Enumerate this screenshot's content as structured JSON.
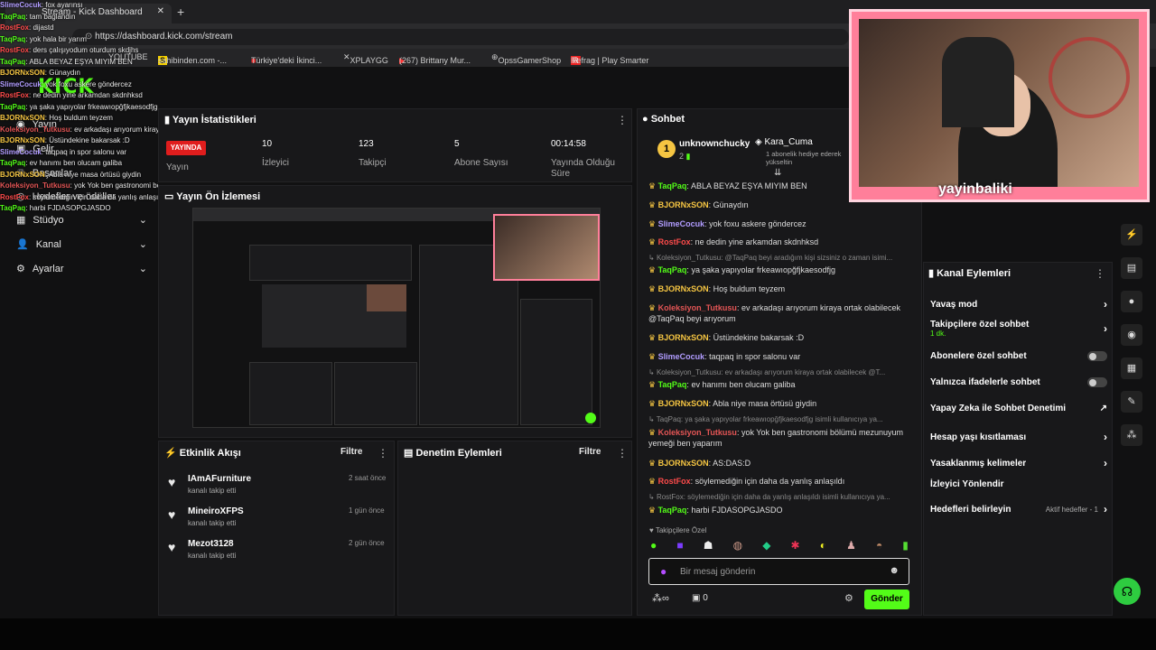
{
  "browser": {
    "tab_title": "Stream - Kick Dashboard",
    "url": "https://dashboard.kick.com/stream",
    "bookmarks": [
      "YOUTUBE",
      "sahibinden.com -...",
      "Türkiye'deki İkinci...",
      "XPLAYGG",
      "(267) Brittany Mur...",
      "OpssGamerShop",
      "Refrag | Play Smarter"
    ]
  },
  "overlay_chat": [
    {
      "u": "SlimeCocuk",
      "m": "fox ayarınsı",
      "c": "u1"
    },
    {
      "u": "TaqPaq",
      "m": "tam bağlandın",
      "c": "u2"
    },
    {
      "u": "RostFox",
      "m": "dijastd",
      "c": "u3"
    },
    {
      "u": "TaqPaq",
      "m": "yok hala bir yarım",
      "c": "u2"
    },
    {
      "u": "RostFox",
      "m": "ders çalışıyodum oturdum skdjhs",
      "c": "u3"
    },
    {
      "u": "TaqPaq",
      "m": "ABLA BEYAZ EŞYA MIYIM BEN",
      "c": "u2"
    },
    {
      "u": "BJORNxSON",
      "m": "Günaydın",
      "c": "u5"
    },
    {
      "u": "SlimeCocuk",
      "m": "yok foxu askere göndercez",
      "c": "u1"
    },
    {
      "u": "RostFox",
      "m": "ne dedin yine arkamdan skdnhksd",
      "c": "u3"
    },
    {
      "u": "TaqPaq",
      "m": "ya şaka yapıyolar frkeawıopğfjkaesodfjg",
      "c": "u2"
    },
    {
      "u": "BJORNxSON",
      "m": "Hoş buldum teyzem",
      "c": "u5"
    },
    {
      "u": "Koleksiyon_Tutkusu",
      "m": "ev arkadaşı arıyorum kiraya ortak olabilecek @TaqPaq beyi arıyorum",
      "c": "u6"
    },
    {
      "u": "BJORNxSON",
      "m": "Üstündekine bakarsak :D",
      "c": "u5"
    },
    {
      "u": "SlimeCocuk",
      "m": "taqpaq in spor salonu var",
      "c": "u1"
    },
    {
      "u": "TaqPaq",
      "m": "ev hanımı ben olucam galiba",
      "c": "u2"
    },
    {
      "u": "BJORNxSON",
      "m": "Abla niye masa örtüsü giydin",
      "c": "u5"
    },
    {
      "u": "Koleksiyon_Tutkusu",
      "m": "yok Yok ben gastronomi bölümü mezunuyum yemeği ben yaparım",
      "c": "u6"
    },
    {
      "u": "RostFox",
      "m": "söylemediğin için daha da yanlış anlaşıldı",
      "c": "u3"
    },
    {
      "u": "TaqPaq",
      "m": "harbi FJDASOPGJASDO",
      "c": "u2"
    }
  ],
  "sidebar": {
    "items": [
      {
        "label": "Yayın"
      },
      {
        "label": "Gelir"
      },
      {
        "label": "Başarılar"
      },
      {
        "label": "Hedefler ve ödüller"
      },
      {
        "label": "Stüdyo"
      },
      {
        "label": "Kanal"
      },
      {
        "label": "Ayarlar"
      }
    ]
  },
  "stats": {
    "title": "Yayın İstatistikleri",
    "live_badge": "YAYINDA",
    "items": [
      {
        "value": "",
        "label": "Yayın"
      },
      {
        "value": "10",
        "label": "İzleyici"
      },
      {
        "value": "123",
        "label": "Takipçi"
      },
      {
        "value": "5",
        "label": "Abone Sayısı"
      },
      {
        "value": "00:14:58",
        "label": "Yayında Olduğu Süre"
      }
    ]
  },
  "preview": {
    "title": "Yayın Ön İzlemesi"
  },
  "activity": {
    "title": "Etkinlik Akışı",
    "filter": "Filtre",
    "items": [
      {
        "name": "IAmAFurniture",
        "sub": "kanalı takip etti",
        "time": "2 saat önce"
      },
      {
        "name": "MineiroXFPS",
        "sub": "kanalı takip etti",
        "time": "1 gün önce"
      },
      {
        "name": "Mezot3128",
        "sub": "kanalı takip etti",
        "time": "2 gün önce"
      }
    ]
  },
  "moderation": {
    "title": "Denetim Eylemleri",
    "filter": "Filtre"
  },
  "chat": {
    "title": "Sohbet",
    "top_gifter": "unknownchucky",
    "top_count": "2",
    "gift_user": "Kara_Cuma",
    "gift_text": "1 abonelik hediye ederek yükseltin",
    "placeholder": "Bir mesaj gönderin",
    "send": "Gönder",
    "followers_label": "Takipçilere Özel",
    "count": "0",
    "messages": [
      {
        "type": "msg",
        "name": "TaqPaq",
        "text": "ABLA BEYAZ EŞYA MIYIM BEN",
        "color": "#53fc18"
      },
      {
        "type": "msg",
        "name": "BJORNxSON",
        "text": "Günaydın",
        "color": "#f5c542"
      },
      {
        "type": "msg",
        "name": "SlimeCocuk",
        "text": "yok foxu askere göndercez",
        "color": "#b19cff"
      },
      {
        "type": "msg",
        "name": "RostFox",
        "text": "ne dedin yine arkamdan skdnhksd",
        "color": "#ff4b4b"
      },
      {
        "type": "reply",
        "text": "Koleksiyon_Tutkusu: @TaqPaq beyi aradığım kişi sizsiniz o zaman isimi..."
      },
      {
        "type": "msg",
        "name": "TaqPaq",
        "text": "ya şaka yapıyolar frkeawıopğfjkaesodfjg",
        "color": "#53fc18"
      },
      {
        "type": "msg",
        "name": "BJORNxSON",
        "text": "Hoş buldum teyzem",
        "color": "#f5c542"
      },
      {
        "type": "msg",
        "name": "Koleksiyon_Tutkusu",
        "text": "ev arkadaşı arıyorum kiraya ortak olabilecek @TaqPaq beyi arıyorum",
        "color": "#e35555"
      },
      {
        "type": "msg",
        "name": "BJORNxSON",
        "text": "Üstündekine bakarsak :D",
        "color": "#f5c542"
      },
      {
        "type": "msg",
        "name": "SlimeCocuk",
        "text": "taqpaq in spor salonu var",
        "color": "#b19cff"
      },
      {
        "type": "reply",
        "text": "Koleksiyon_Tutkusu: ev arkadaşı arıyorum kiraya ortak olabilecek @T..."
      },
      {
        "type": "msg",
        "name": "TaqPaq",
        "text": "ev hanımı ben olucam galiba",
        "color": "#53fc18"
      },
      {
        "type": "msg",
        "name": "BJORNxSON",
        "text": "Abla niye masa örtüsü giydin",
        "color": "#f5c542"
      },
      {
        "type": "reply",
        "text": "TaqPaq: ya şaka yapıyolar frkeawıopğfjkaesodfjg isimli kullanıcıya ya..."
      },
      {
        "type": "msg",
        "name": "Koleksiyon_Tutkusu",
        "text": "yok Yok ben gastronomi bölümü mezunuyum yemeği ben yaparım",
        "color": "#e35555"
      },
      {
        "type": "msg",
        "name": "BJORNxSON",
        "text": "AS:DAS:D",
        "color": "#f5c542"
      },
      {
        "type": "msg",
        "name": "RostFox",
        "text": "söylemediğin için daha da yanlış anlaşıldı",
        "color": "#ff4b4b"
      },
      {
        "type": "reply",
        "text": "RostFox: söylemediğin için daha da yanlış anlaşıldı isimli kullanıcıya ya..."
      },
      {
        "type": "msg",
        "name": "TaqPaq",
        "text": "harbi FJDASOPGJASDO",
        "color": "#53fc18"
      }
    ]
  },
  "actions": {
    "title": "Kanal Eylemleri",
    "items": [
      {
        "label": "Yavaş mod",
        "kind": "chevron"
      },
      {
        "label": "Takipçilere özel sohbet",
        "sub": "1 dk.",
        "kind": "chevron"
      },
      {
        "label": "Abonelere özel sohbet",
        "kind": "toggle"
      },
      {
        "label": "Yalnızca ifadelerle sohbet",
        "kind": "toggle"
      },
      {
        "label": "Yapay Zeka ile Sohbet Denetimi",
        "kind": "external"
      },
      {
        "label": "Hesap yaşı kısıtlaması",
        "kind": "chevron"
      },
      {
        "label": "Yasaklanmış kelimeler",
        "kind": "chevron"
      },
      {
        "label": "İzleyici Yönlendir",
        "kind": "none"
      },
      {
        "label": "Hedefleri belirleyin",
        "extra": "Aktif hedefler - 1",
        "kind": "chevron"
      }
    ]
  },
  "webcam": {
    "name_tag": "yayinbaliki"
  },
  "colors": {
    "accent": "#53fc18",
    "live": "#e01d1d",
    "panel": "#18181a"
  }
}
